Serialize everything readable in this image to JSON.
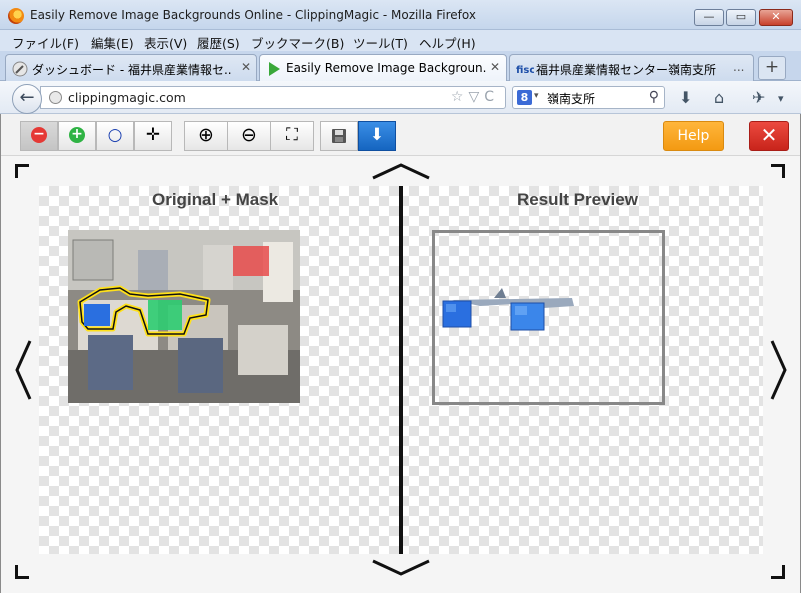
{
  "window": {
    "title": "Easily Remove Image Backgrounds Online - ClippingMagic - Mozilla Firefox",
    "min": "—",
    "max": "▭",
    "close": "✕"
  },
  "menu": [
    "ファイル(F)",
    "編集(E)",
    "表示(V)",
    "履歴(S)",
    "ブックマーク(B)",
    "ツール(T)",
    "ヘルプ(H)"
  ],
  "tabs": [
    {
      "label": "ダッシュボード - 福井県産業情報セ...",
      "close": "✕"
    },
    {
      "label": "Easily Remove Image Backgroun...",
      "close": "✕"
    },
    {
      "label": "福井県産業情報センター嶺南支所",
      "close": "..."
    }
  ],
  "newtab": "+",
  "nav": {
    "back": "←",
    "url": "clippingmagic.com",
    "url_icons": "☆▽C",
    "search_engine": "8",
    "search_value": "嶺南支所",
    "search_icon": "⚲",
    "download": "⬇",
    "home": "⌂",
    "addon": "✈",
    "more": "▾"
  },
  "toolbar": {
    "remove": "−",
    "add": "+",
    "hair": "○",
    "move": "✛",
    "zoom_in": "⊕",
    "zoom_out": "⊖",
    "fit": "⛶",
    "save": "💾",
    "download": "⬇",
    "help": "Help",
    "close": "✕"
  },
  "panes": {
    "left_title": "Original + Mask",
    "right_title": "Result Preview"
  },
  "arrows": {
    "up": "︿",
    "down": "﹀",
    "left": "〈",
    "right": "〉"
  },
  "colors": {
    "keep_mask": "#2ecc71",
    "remove_mask": "#e53935",
    "outline": "#ffe11a",
    "help_orange": "#f39a12",
    "close_red": "#c8241b",
    "download_blue": "#1565c0"
  }
}
